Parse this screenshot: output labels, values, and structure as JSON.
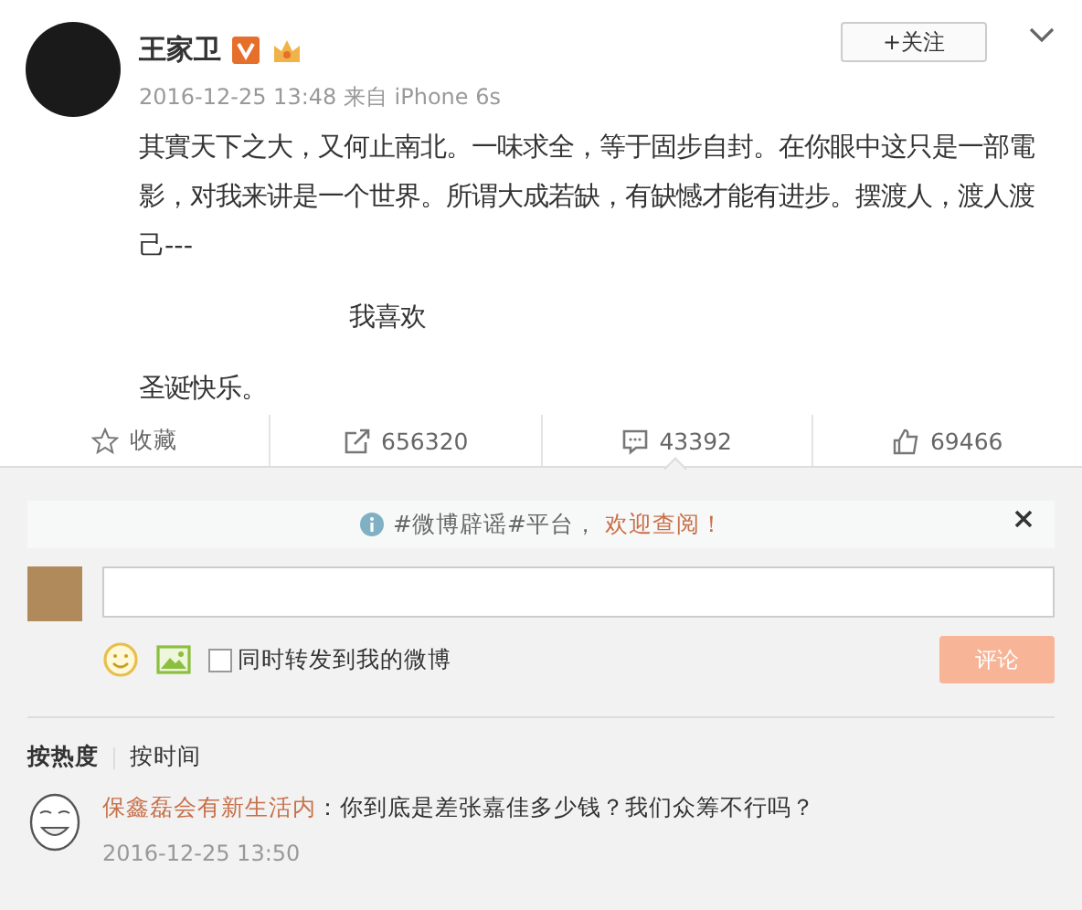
{
  "post": {
    "author": "王家卫",
    "verified": true,
    "meta": "2016-12-25 13:48 来自 iPhone 6s",
    "follow_button": "+关注",
    "paragraphs": [
      {
        "kind": "text",
        "text": "其實天下之大，又何止南北。一味求全，等于固步自封。在你眼中这只是一部電影，对我来讲是一个世界。所谓大成若缺，有缺憾才能有进步。摆渡人，渡人渡己---"
      },
      {
        "kind": "indented",
        "text": "我喜欢"
      },
      {
        "kind": "text",
        "text": "圣诞快乐。"
      }
    ],
    "actions": [
      {
        "kind": "favorite",
        "label": "收藏",
        "selected": false
      },
      {
        "kind": "repost",
        "label": "656320",
        "selected": false
      },
      {
        "kind": "comment",
        "label": "43392",
        "selected": true
      },
      {
        "kind": "like",
        "label": "69466",
        "selected": false
      }
    ]
  },
  "notice": {
    "text": "#微博辟谣#平台，",
    "link": "欢迎查阅！"
  },
  "composer": {
    "repost_option": {
      "label": "同时转发到我的微博",
      "checked": false
    },
    "submit_button": {
      "label": "评论",
      "disabled": true
    }
  },
  "sort_tabs": [
    {
      "label": "按热度",
      "selected": true
    },
    {
      "label": "按时间",
      "selected": false
    }
  ],
  "comments": [
    {
      "user": "保鑫磊会有新生活内",
      "text": "：你到底是差张嘉佳多少钱？我们众筹不行吗？",
      "time": "2016-12-25 13:50"
    }
  ]
}
